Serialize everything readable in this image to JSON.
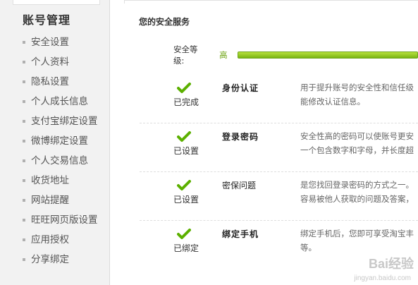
{
  "sidebar": {
    "title": "账号管理",
    "items": [
      {
        "label": "安全设置"
      },
      {
        "label": "个人资料"
      },
      {
        "label": "隐私设置"
      },
      {
        "label": "个人成长信息"
      },
      {
        "label": "支付宝绑定设置"
      },
      {
        "label": "微博绑定设置"
      },
      {
        "label": "个人交易信息"
      },
      {
        "label": "收货地址"
      },
      {
        "label": "网站提醒"
      },
      {
        "label": "旺旺网页版设置"
      },
      {
        "label": "应用授权"
      },
      {
        "label": "分享绑定"
      }
    ]
  },
  "main": {
    "section_title": "您的安全服务",
    "level": {
      "label": "安全等级:",
      "value": "高",
      "fraction": 1.0
    },
    "items": [
      {
        "status": "已完成",
        "name": "身份认证",
        "desc_line1": "用于提升账号的安全性和信任级",
        "desc_line2": "能修改认证信息。"
      },
      {
        "status": "已设置",
        "name": "登录密码",
        "desc_line1": "安全性高的密码可以使账号更安",
        "desc_line2": "一个包含数字和字母，并长度超"
      },
      {
        "status": "已设置",
        "name": "密保问题",
        "desc_line1": "是您找回登录密码的方式之一。",
        "desc_line2": "容易被他人获取的问题及答案，"
      },
      {
        "status": "已绑定",
        "name": "绑定手机",
        "desc_line1": "绑定手机后，您即可享受淘宝丰",
        "desc_line2": "等。"
      }
    ],
    "check_color": "#5cb000"
  },
  "watermark": {
    "brand": "Bai经验",
    "url": "jingyan.baidu.com"
  }
}
